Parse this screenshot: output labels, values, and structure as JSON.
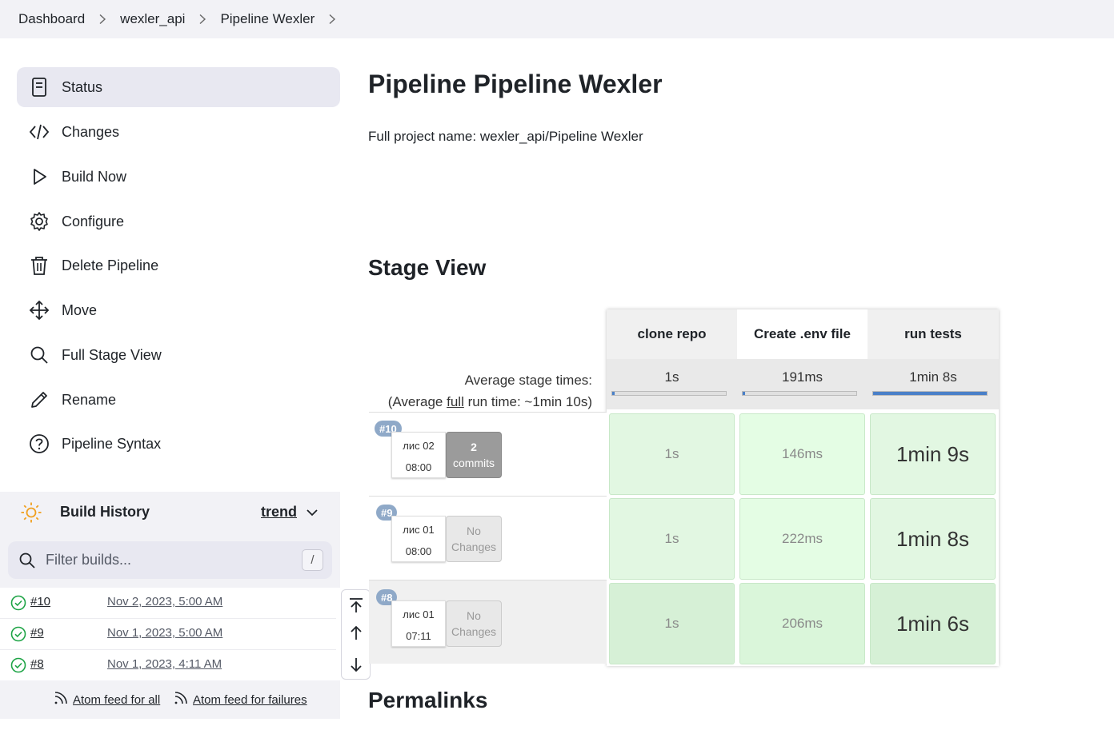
{
  "breadcrumb": [
    {
      "label": "Dashboard"
    },
    {
      "label": "wexler_api"
    },
    {
      "label": "Pipeline Wexler"
    }
  ],
  "sidebar": {
    "items": [
      {
        "label": "Status",
        "icon": "document-icon",
        "active": true
      },
      {
        "label": "Changes",
        "icon": "code-icon"
      },
      {
        "label": "Build Now",
        "icon": "play-icon"
      },
      {
        "label": "Configure",
        "icon": "gear-icon"
      },
      {
        "label": "Delete Pipeline",
        "icon": "trash-icon"
      },
      {
        "label": "Move",
        "icon": "move-icon"
      },
      {
        "label": "Full Stage View",
        "icon": "search-icon"
      },
      {
        "label": "Rename",
        "icon": "pencil-icon"
      },
      {
        "label": "Pipeline Syntax",
        "icon": "help-icon"
      }
    ]
  },
  "build_history": {
    "title": "Build History",
    "trend_label": "trend",
    "filter_placeholder": "Filter builds...",
    "shortcut_key": "/",
    "builds": [
      {
        "number": "#10",
        "date": "Nov 2, 2023, 5:00 AM",
        "status": "success"
      },
      {
        "number": "#9",
        "date": "Nov 1, 2023, 5:00 AM",
        "status": "success"
      },
      {
        "number": "#8",
        "date": "Nov 1, 2023, 4:11 AM",
        "status": "success"
      }
    ],
    "feed_all": "Atom feed for all",
    "feed_failures": "Atom feed for failures"
  },
  "main": {
    "title": "Pipeline Pipeline Wexler",
    "full_name": "Full project name: wexler_api/Pipeline Wexler",
    "stage_view_title": "Stage View",
    "permalinks_title": "Permalinks"
  },
  "stage_view": {
    "avg_stage_label": "Average stage times:",
    "avg_full_prefix": "(Average ",
    "avg_full_word": "full",
    "avg_full_suffix": " run time: ~1min 10s)",
    "stages": [
      {
        "name": "clone repo",
        "avg": "1s",
        "avg_fraction": 0.02
      },
      {
        "name": "Create .env file",
        "avg": "191ms",
        "avg_fraction": 0.02
      },
      {
        "name": "run tests",
        "avg": "1min 8s",
        "avg_fraction": 1.0
      }
    ],
    "runs": [
      {
        "badge": "#10",
        "date": "лис 02",
        "time": "08:00",
        "changes_line1": "2",
        "changes_line2": "commits",
        "has_changes": true,
        "durations": [
          "1s",
          "146ms",
          "1min 9s"
        ]
      },
      {
        "badge": "#9",
        "date": "лис 01",
        "time": "08:00",
        "changes_line1": "No",
        "changes_line2": "Changes",
        "has_changes": false,
        "durations": [
          "1s",
          "222ms",
          "1min 8s"
        ]
      },
      {
        "badge": "#8",
        "date": "лис 01",
        "time": "07:11",
        "changes_line1": "No",
        "changes_line2": "Changes",
        "has_changes": false,
        "durations": [
          "1s",
          "206ms",
          "1min 6s"
        ]
      }
    ]
  },
  "colors": {
    "cell_success": "#e2f7e2",
    "cell_success_alt": "#d6f0d6",
    "badge": "#8fa9c8",
    "progress": "#4a80c8"
  }
}
